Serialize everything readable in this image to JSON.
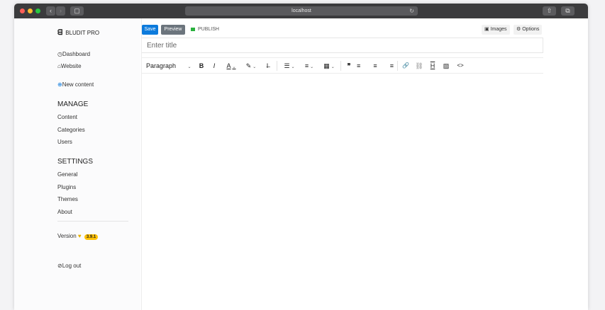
{
  "browser": {
    "url": "localhost",
    "reload_icon": "↻",
    "back_icon": "‹",
    "forward_icon": "›",
    "sidebar_icon": "▢",
    "share_icon": "⇧",
    "tabs_icon": "⧉"
  },
  "sidebar": {
    "brand": "BLUDIT PRO",
    "brand_icon": "ᗺ",
    "dashboard": "Dashboard",
    "dashboard_icon": "◷",
    "website": "Website",
    "website_icon": "⌂",
    "new_content": "New content",
    "new_content_icon": "⊕",
    "manage_heading": "MANAGE",
    "manage_items": [
      "Content",
      "Categories",
      "Users"
    ],
    "settings_heading": "SETTINGS",
    "settings_items": [
      "General",
      "Plugins",
      "Themes",
      "About"
    ],
    "version_label": "Version",
    "version_heart": "♥",
    "version_number": "3.9.1",
    "logout": "Log out",
    "logout_icon": "⊘"
  },
  "editor": {
    "save": "Save",
    "preview": "Preview",
    "status": "PUBLISH",
    "status_color": "#2ab13e",
    "images": "Images",
    "images_icon": "▣",
    "options": "Options",
    "options_icon": "⚙",
    "title_placeholder": "Enter title",
    "title_value": "",
    "format_select": "Paragraph",
    "chevron": "⌄",
    "toolbar": {
      "bold": "B",
      "italic": "I",
      "text_color": "A",
      "highlight": "✎",
      "clear_format": "I̶",
      "bullet_list": "☰",
      "numbered_list": "≡",
      "table": "▦",
      "blockquote": "❞",
      "align_left": "≡",
      "align_center": "≡",
      "align_right": "≡",
      "link": "🔗",
      "unlink": "⛓",
      "page_break": "H",
      "image": "▨",
      "code": "<>"
    }
  },
  "colors": {
    "accent": "#0d7bdc",
    "preview": "#6c757d",
    "badge": "#ffc107"
  }
}
